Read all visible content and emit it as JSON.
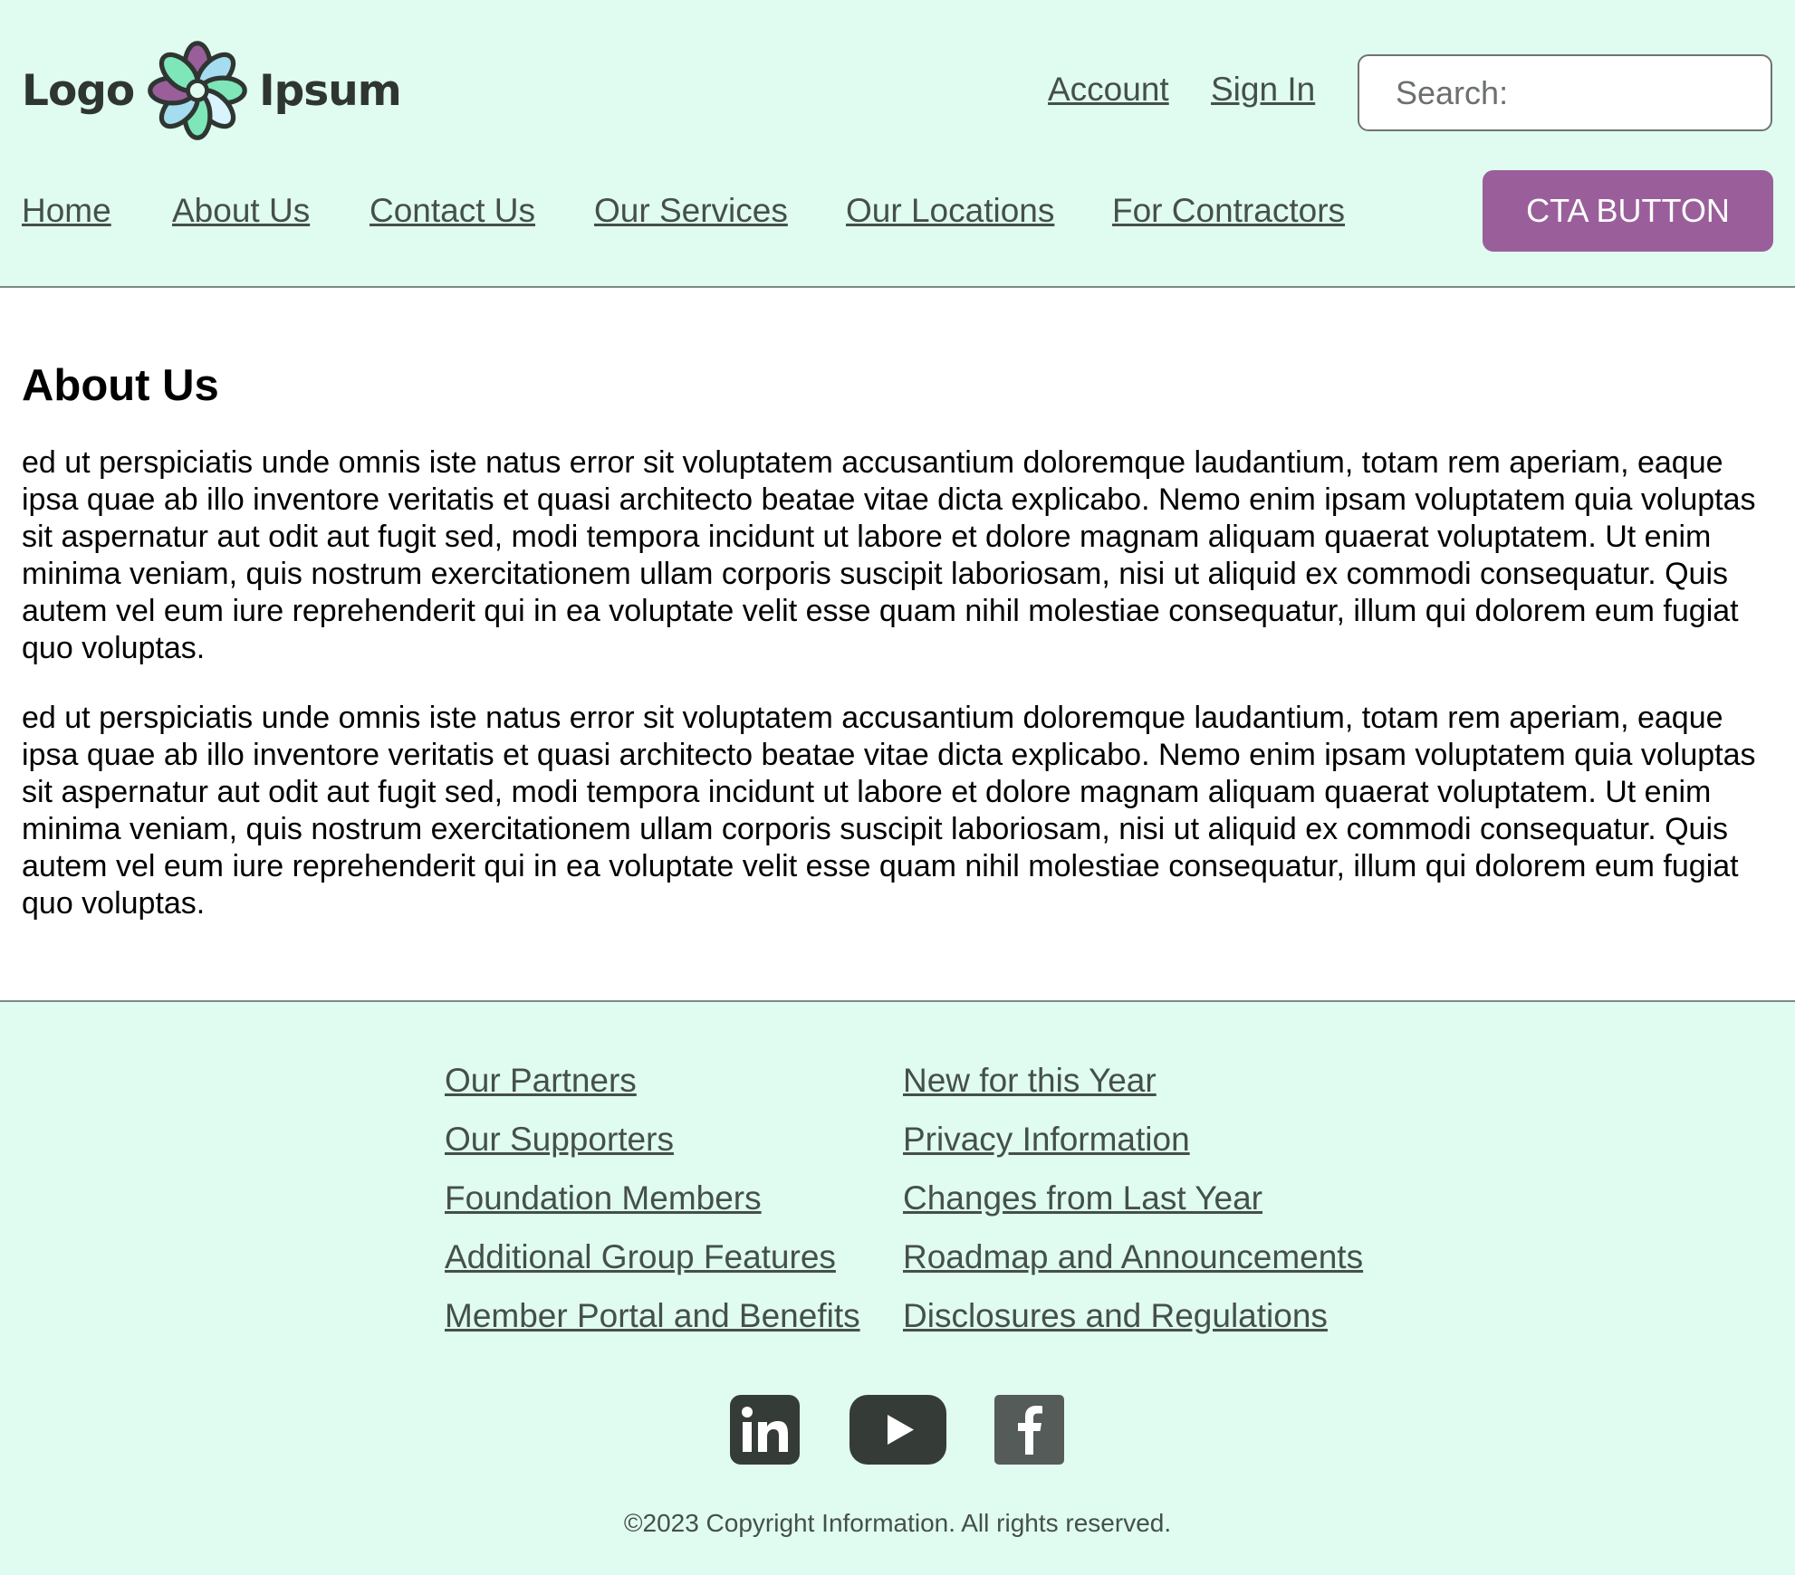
{
  "header": {
    "logo": {
      "word_left": "Logo",
      "word_right": "Ipsum"
    },
    "utility": {
      "account": "Account",
      "sign_in": "Sign In"
    },
    "search": {
      "placeholder": "Search:"
    },
    "nav": [
      "Home",
      "About Us",
      "Contact Us",
      "Our Services",
      "Our Locations",
      "For Contractors"
    ],
    "cta_label": "CTA BUTTON"
  },
  "main": {
    "title": "About Us",
    "paragraphs": [
      "ed ut perspiciatis unde omnis iste natus error sit voluptatem accusantium doloremque laudantium, totam rem aperiam, eaque ipsa quae ab illo inventore veritatis et quasi architecto beatae vitae dicta explicabo. Nemo enim ipsam voluptatem quia voluptas sit aspernatur aut odit aut fugit sed, modi tempora incidunt ut labore et dolore magnam aliquam quaerat voluptatem. Ut enim minima veniam, quis nostrum exercitationem ullam corporis suscipit laboriosam, nisi ut aliquid ex commodi consequatur. Quis autem vel eum iure reprehenderit qui in ea voluptate velit esse quam nihil molestiae consequatur, illum qui dolorem eum fugiat quo voluptas.",
      "ed ut perspiciatis unde omnis iste natus error sit voluptatem accusantium doloremque laudantium, totam rem aperiam, eaque ipsa quae ab illo inventore veritatis et quasi architecto beatae vitae dicta explicabo. Nemo enim ipsam voluptatem quia voluptas sit aspernatur aut odit aut fugit sed, modi tempora incidunt ut labore et dolore magnam aliquam quaerat voluptatem. Ut enim minima veniam, quis nostrum exercitationem ullam corporis suscipit laboriosam, nisi ut aliquid ex commodi consequatur. Quis autem vel eum iure reprehenderit qui in ea voluptate velit esse quam nihil molestiae consequatur, illum qui dolorem eum fugiat quo voluptas."
    ]
  },
  "footer": {
    "col1": [
      "Our Partners",
      "Our Supporters",
      "Foundation Members",
      "Additional Group Features",
      "Member Portal and Benefits"
    ],
    "col2": [
      "New for this Year",
      "Privacy Information",
      "Changes from Last Year",
      "Roadmap and Announcements",
      "Disclosures and Regulations"
    ],
    "social_icons": [
      "linkedin-icon",
      "youtube-icon",
      "facebook-icon"
    ],
    "copyright": "©2023 Copyright Information. All rights reserved."
  },
  "colors": {
    "header_bg": "#e0fcf1",
    "link": "#45504a",
    "cta_bg": "#9a5f9a",
    "cta_text": "#ffffff",
    "logo_petal_purple": "#9a5f9a",
    "logo_petal_green": "#7ee6b8",
    "logo_petal_blue": "#a6dcf0"
  }
}
